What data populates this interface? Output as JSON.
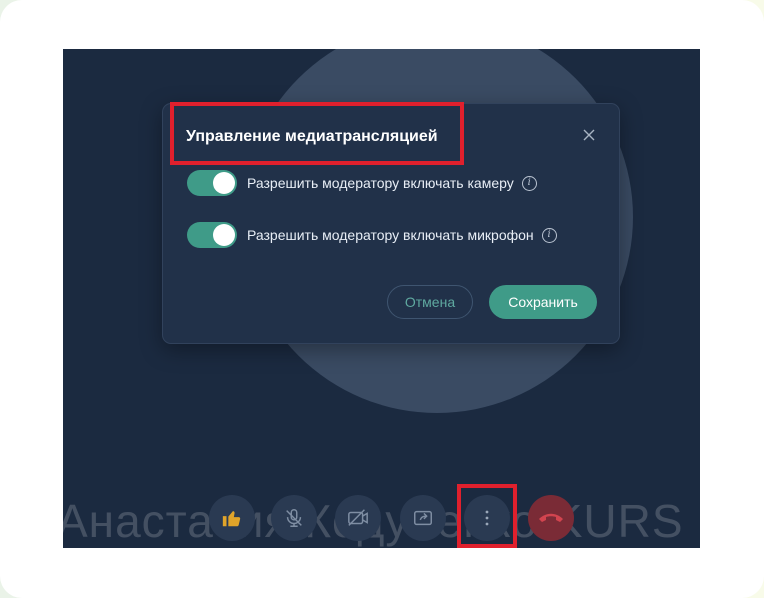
{
  "background_participant": {
    "name_overlay": "Анастасия Кодубенко KURS"
  },
  "dialog": {
    "title": "Управление медиатрансляцией",
    "close_icon": "close-icon",
    "options": [
      {
        "label": "Разрешить модератору включать камеру",
        "enabled": true
      },
      {
        "label": "Разрешить модератору включать микрофон",
        "enabled": true
      }
    ],
    "info_glyph": "i",
    "cancel_label": "Отмена",
    "save_label": "Сохранить"
  },
  "toolbar": {
    "buttons": [
      "thumbs-up-icon",
      "microphone-off-icon",
      "camera-off-icon",
      "share-screen-icon",
      "more-vertical-icon",
      "hang-up-icon"
    ]
  },
  "colors": {
    "stage_bg": "#1b2a40",
    "dialog_bg": "#213149",
    "accent_green": "#3f9b88",
    "highlight_red": "#e0202d"
  }
}
